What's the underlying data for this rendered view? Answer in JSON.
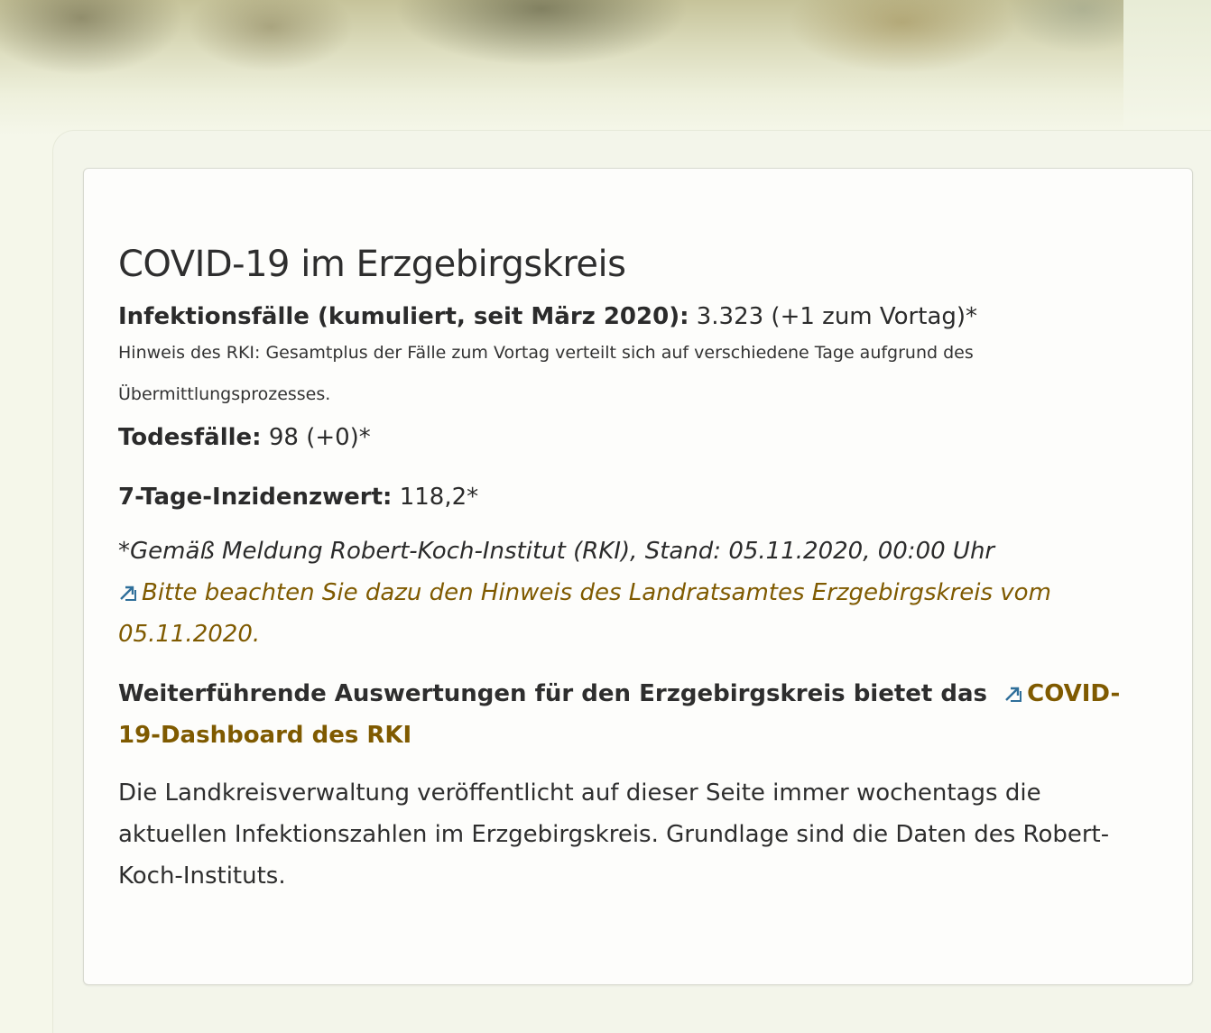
{
  "title": "COVID-19 im Erzgebirgskreis",
  "infections": {
    "label": "Infektionsfälle (kumuliert, seit März 2020):",
    "value": " 3.323 (+1 zum Vortag)*"
  },
  "rki_note": "Hinweis des RKI: Gesamtplus der Fälle zum Vortag verteilt sich auf verschiedene Tage aufgrund des Übermittlungsprozesses.",
  "deaths": {
    "label": "Todesfälle:",
    "value": " 98 (+0)*"
  },
  "incidence": {
    "label": "7-Tage-Inzidenzwert:",
    "value": " 118,2*"
  },
  "source_note": "*Gemäß Meldung Robert-Koch-Institut (RKI), Stand: 05.11.2020, 00:00 Uhr",
  "landrat_link": "Bitte beachten Sie dazu den Hinweis des Landratsamtes Erzgebirgskreis vom 05.11.2020.",
  "dashboard": {
    "text": "Weiterführende Auswertungen für den Erzgebirgskreis bietet das",
    "link": "COVID-19-Dashboard des RKI"
  },
  "description": "Die Landkreisverwaltung veröffentlicht auf dieser Seite immer wochentags die aktuellen Infektionszahlen im Erzgebirgskreis. Grundlage sind die Daten des Robert-Koch-Instituts.",
  "colors": {
    "link": "#7f5a00",
    "icon": "#2f6f9a",
    "background": "#f5f7ea"
  },
  "icons": {
    "external_link": "external-link-arrow-icon"
  }
}
